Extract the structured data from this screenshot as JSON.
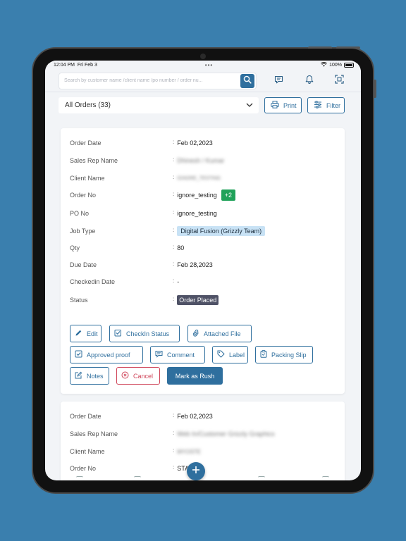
{
  "status_bar": {
    "time": "12:04 PM",
    "date": "Fri Feb 3",
    "dots": "•••",
    "battery": "100%"
  },
  "search": {
    "placeholder": "Search by customer name /client name /po number / order nu..."
  },
  "toolbar": {
    "dropdown_label": "All Orders (33)",
    "print_label": "Print",
    "filter_label": "Filter"
  },
  "orders": [
    {
      "fields": {
        "order_date": {
          "label": "Order Date",
          "value": "Feb 02,2023"
        },
        "sales_rep": {
          "label": "Sales Rep Name",
          "value": "Dhinesh / Kumar"
        },
        "client": {
          "label": "Client Name",
          "value": "IGNORE_TESTING"
        },
        "order_no": {
          "label": "Order No",
          "value": "ignore_testing",
          "badge": "+2"
        },
        "po_no": {
          "label": "PO No",
          "value": "ignore_testing"
        },
        "job_type": {
          "label": "Job Type",
          "value": "Digital Fusion (Grizzly Team)"
        },
        "qty": {
          "label": "Qty",
          "value": "80"
        },
        "due_date": {
          "label": "Due Date",
          "value": "Feb 28,2023"
        },
        "checkin_date": {
          "label": "Checkedin Date",
          "value": "-"
        },
        "status": {
          "label": "Status",
          "value": "Order Placed"
        }
      },
      "actions": {
        "edit": "Edit",
        "checkin_status": "CheckIn Status",
        "attached_file": "Attached File",
        "approved_proof": "Approved proof",
        "comment": "Comment",
        "label": "Label",
        "packing_slip": "Packing Slip",
        "notes": "Notes",
        "cancel": "Cancel",
        "mark_rush": "Mark as Rush"
      }
    },
    {
      "fields": {
        "order_date": {
          "label": "Order Date",
          "value": "Feb 02,2023"
        },
        "sales_rep": {
          "label": "Sales Rep Name",
          "value": "Web In/Customer Grizzly Graphics"
        },
        "client": {
          "label": "Client Name",
          "value": "MYOSTE"
        },
        "order_no": {
          "label": "Order No",
          "value": "STA"
        }
      }
    }
  ],
  "colors": {
    "primary": "#2f6f9e",
    "success": "#20a25a",
    "danger": "#d0465a",
    "status_badge": "#4f5266",
    "job_badge": "#c8e2f5",
    "background": "#3a7fae"
  }
}
